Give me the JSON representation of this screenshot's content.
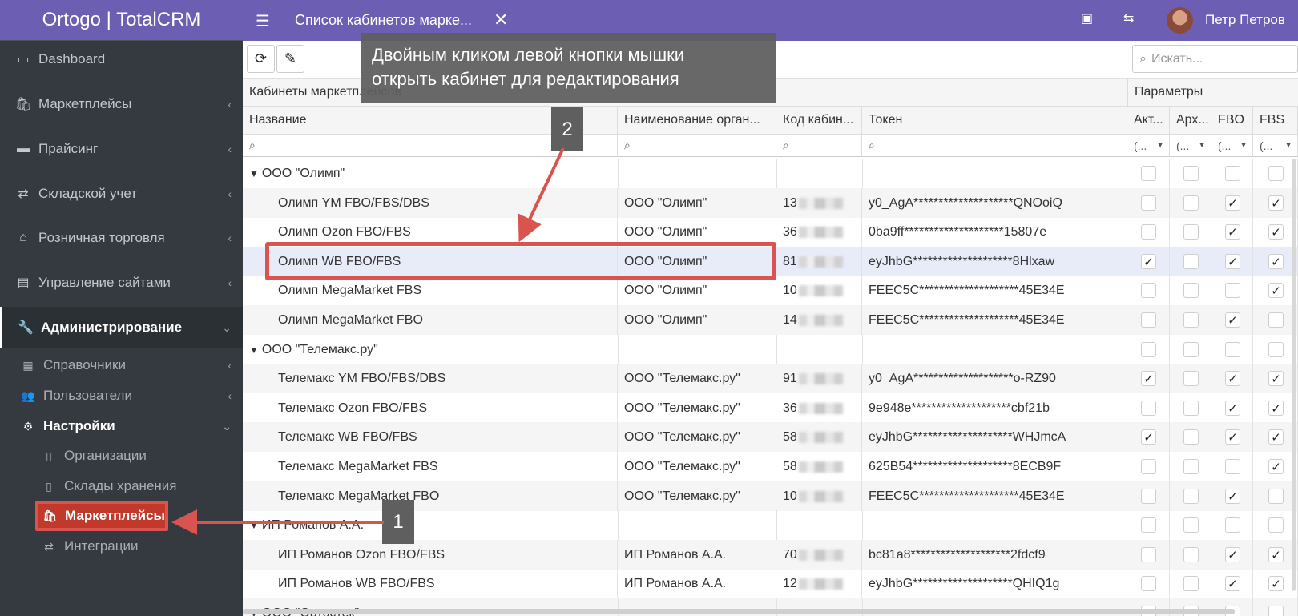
{
  "app": {
    "brand": "Ortogo | TotalCRM",
    "tab_title": "Список кабинетов марке...",
    "user_name": "Петр Петров"
  },
  "sidebar": {
    "items": [
      {
        "label": "Dashboard",
        "icon": "monitor-icon",
        "chevron": ""
      },
      {
        "label": "Маркетплейсы",
        "icon": "shopping-bag-icon",
        "chevron": "‹"
      },
      {
        "label": "Прайсинг",
        "icon": "credit-card-icon",
        "chevron": "‹"
      },
      {
        "label": "Складской учет",
        "icon": "exchange-icon",
        "chevron": "‹"
      },
      {
        "label": "Розничная торговля",
        "icon": "bank-icon",
        "chevron": "‹"
      },
      {
        "label": "Управление сайтами",
        "icon": "newspaper-icon",
        "chevron": "‹"
      },
      {
        "label": "Администрирование",
        "icon": "wrench-icon",
        "chevron": "⌄"
      }
    ],
    "sub_items": [
      {
        "label": "Справочники",
        "icon": "id-card-icon",
        "chevron": "‹"
      },
      {
        "label": "Пользователи",
        "icon": "users-icon",
        "chevron": "‹"
      },
      {
        "label": "Настройки",
        "icon": "cogs-icon",
        "chevron": "⌄"
      },
      {
        "label": "Организации",
        "icon": "file-icon",
        "chevron": ""
      },
      {
        "label": "Склады хранения",
        "icon": "file-icon",
        "chevron": ""
      },
      {
        "label": "Маркетплейсы",
        "icon": "shopping-bag-icon",
        "chevron": ""
      },
      {
        "label": "Интеграции",
        "icon": "exchange-icon",
        "chevron": ""
      }
    ]
  },
  "toolbar": {
    "search_placeholder": "Искать..."
  },
  "grid": {
    "band_left": "Кабинеты маркетплейсов",
    "band_right": "Параметры",
    "columns": [
      "Название",
      "Наименование орган...",
      "Код кабин...",
      "Токен",
      "Акт...",
      "Арх...",
      "FBO",
      "FBS"
    ],
    "filter_dd": "(...",
    "rows": [
      {
        "type": "group",
        "name": "ООО \"Олимп\""
      },
      {
        "type": "data",
        "name": "Олимп YM FBO/FBS/DBS",
        "org": "ООО \"Олимп\"",
        "code": "13",
        "token": "y0_AgA********************QNOoiQ",
        "act": false,
        "arch": false,
        "fbo": true,
        "fbs": true
      },
      {
        "type": "data",
        "name": "Олимп Ozon FBO/FBS",
        "org": "ООО \"Олимп\"",
        "code": "36",
        "token": "0ba9ff********************15807e",
        "act": false,
        "arch": false,
        "fbo": true,
        "fbs": true
      },
      {
        "type": "data",
        "name": "Олимп WB FBO/FBS",
        "org": "ООО \"Олимп\"",
        "code": "81",
        "token": "eyJhbG********************8Hlxaw",
        "act": true,
        "arch": false,
        "fbo": true,
        "fbs": true,
        "selected": true
      },
      {
        "type": "data",
        "name": "Олимп MegaMarket FBS",
        "org": "ООО \"Олимп\"",
        "code": "10",
        "token": "FEEC5C********************45E34E",
        "act": false,
        "arch": false,
        "fbo": false,
        "fbs": true
      },
      {
        "type": "data",
        "name": "Олимп MegaMarket FBO",
        "org": "ООО \"Олимп\"",
        "code": "14",
        "token": "FEEC5C********************45E34E",
        "act": false,
        "arch": false,
        "fbo": true,
        "fbs": false
      },
      {
        "type": "group",
        "name": "ООО \"Телемакс.ру\""
      },
      {
        "type": "data",
        "name": "Телемакс YM FBO/FBS/DBS",
        "org": "ООО \"Телемакс.ру\"",
        "code": "91",
        "token": "y0_AgA********************o-RZ90",
        "act": true,
        "arch": false,
        "fbo": true,
        "fbs": true
      },
      {
        "type": "data",
        "name": "Телемакс Ozon FBO/FBS",
        "org": "ООО \"Телемакс.ру\"",
        "code": "36",
        "token": "9e948e********************cbf21b",
        "act": false,
        "arch": false,
        "fbo": true,
        "fbs": true
      },
      {
        "type": "data",
        "name": "Телемакс WB FBO/FBS",
        "org": "ООО \"Телемакс.ру\"",
        "code": "58",
        "token": "eyJhbG********************WHJmcA",
        "act": true,
        "arch": false,
        "fbo": true,
        "fbs": true
      },
      {
        "type": "data",
        "name": "Телемакс MegaMarket FBS",
        "org": "ООО \"Телемакс.ру\"",
        "code": "58",
        "token": "625B54********************8ECB9F",
        "act": false,
        "arch": false,
        "fbo": false,
        "fbs": true
      },
      {
        "type": "data",
        "name": "Телемакс MegaMarket FBO",
        "org": "ООО \"Телемакс.ру\"",
        "code": "10",
        "token": "FEEC5C********************45E34E",
        "act": false,
        "arch": false,
        "fbo": true,
        "fbs": false
      },
      {
        "type": "group",
        "name": "ИП Романов А.А."
      },
      {
        "type": "data",
        "name": "ИП Романов Ozon FBO/FBS",
        "org": "ИП Романов А.А.",
        "code": "70",
        "token": "bc81a8********************2fdcf9",
        "act": false,
        "arch": false,
        "fbo": true,
        "fbs": true
      },
      {
        "type": "data",
        "name": "ИП Романов WB FBO/FBS",
        "org": "ИП Романов А.А.",
        "code": "12",
        "token": "eyJhbG********************QHIQ1g",
        "act": false,
        "arch": false,
        "fbo": true,
        "fbs": true
      },
      {
        "type": "group",
        "name": "ООО \"Ортостек\""
      }
    ]
  },
  "annotations": {
    "tooltip_line1": "Двойным кликом левой кнопки мышки",
    "tooltip_line2": "открыть кабинет для редактирования",
    "badge1": "1",
    "badge2": "2",
    "highlight_color": "#d9534f"
  }
}
